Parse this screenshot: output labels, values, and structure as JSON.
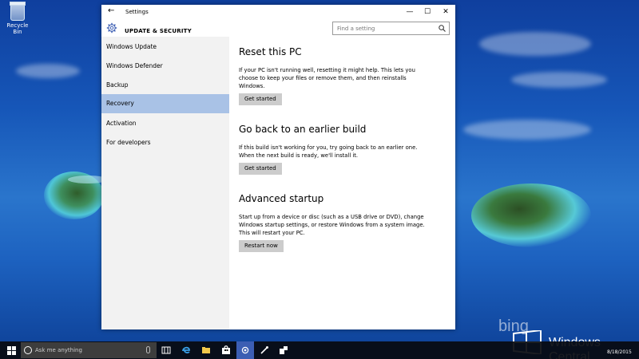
{
  "desktop": {
    "recycle_bin_label": "Recycle Bin"
  },
  "window": {
    "title": "Settings",
    "back_glyph": "←",
    "minimize_glyph": "—",
    "maximize_glyph": "☐",
    "close_glyph": "✕",
    "section_title": "UPDATE & SECURITY",
    "search_placeholder": "Find a setting"
  },
  "sidebar": {
    "items": [
      {
        "label": "Windows Update",
        "selected": false
      },
      {
        "label": "Windows Defender",
        "selected": false
      },
      {
        "label": "Backup",
        "selected": false
      },
      {
        "label": "Recovery",
        "selected": true
      },
      {
        "label": "Activation",
        "selected": false
      },
      {
        "label": "For developers",
        "selected": false
      }
    ]
  },
  "content": {
    "reset": {
      "heading": "Reset this PC",
      "body": "If your PC isn't running well, resetting it might help. This lets you choose to keep your files or remove them, and then reinstalls Windows.",
      "button": "Get started"
    },
    "goback": {
      "heading": "Go back to an earlier build",
      "body": "If this build isn't working for you, try going back to an earlier one. When the next build is ready, we'll install it.",
      "button": "Get started"
    },
    "advanced": {
      "heading": "Advanced startup",
      "body": "Start up from a device or disc (such as a USB drive or DVD), change Windows startup settings, or restore Windows from a system image. This will restart your PC.",
      "button": "Restart now"
    }
  },
  "taskbar": {
    "search_placeholder": "Ask me anything",
    "date": "8/18/2015"
  },
  "watermark": {
    "bing": "bing",
    "brand": "Windows Central"
  },
  "colors": {
    "accent": "#3c5eb3",
    "selected_nav": "#a9c2e6",
    "sidebar_bg": "#f2f2f2",
    "button_bg": "#cccccc"
  }
}
